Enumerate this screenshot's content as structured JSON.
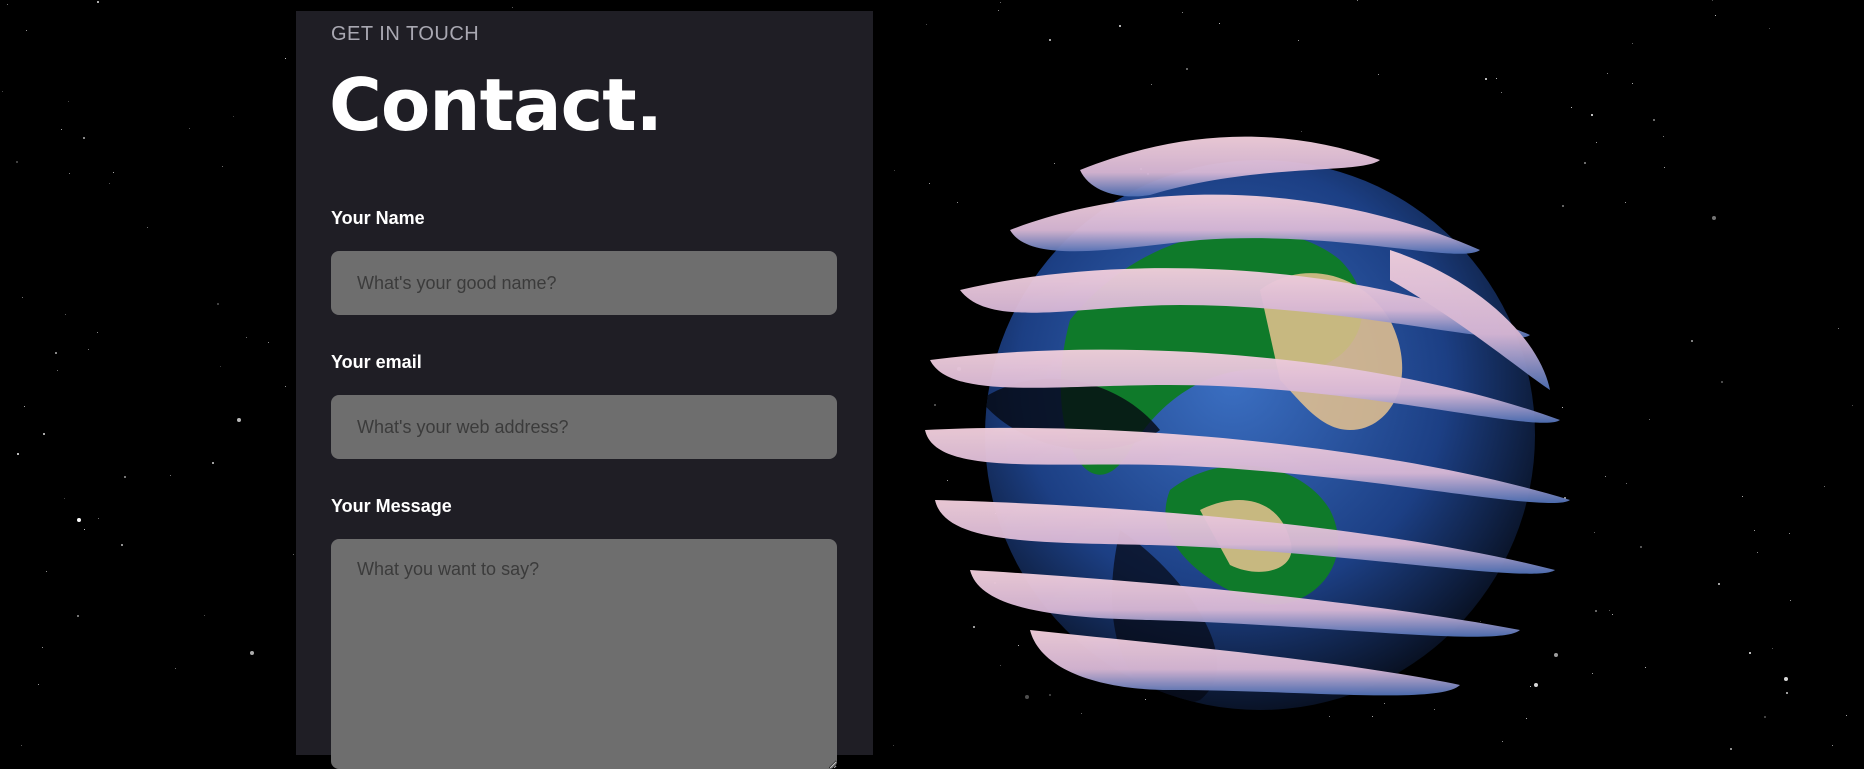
{
  "contact": {
    "eyebrow": "GET IN TOUCH",
    "title": "Contact.",
    "name": {
      "label": "Your Name",
      "placeholder": "What's your good name?",
      "value": ""
    },
    "email": {
      "label": "Your email",
      "placeholder": "What's your web address?",
      "value": ""
    },
    "message": {
      "label": "Your Message",
      "placeholder": "What you want to say?",
      "value": ""
    }
  },
  "colors": {
    "background": "#000000",
    "card": "#1f1e25",
    "input": "#6e6e6e",
    "ocean": "#2e5aa8",
    "land": "#0f7a2a",
    "sand": "#e7c38f",
    "ribbon": "#e8bfd2"
  },
  "scene": {
    "object": "earth-globe-3d"
  }
}
